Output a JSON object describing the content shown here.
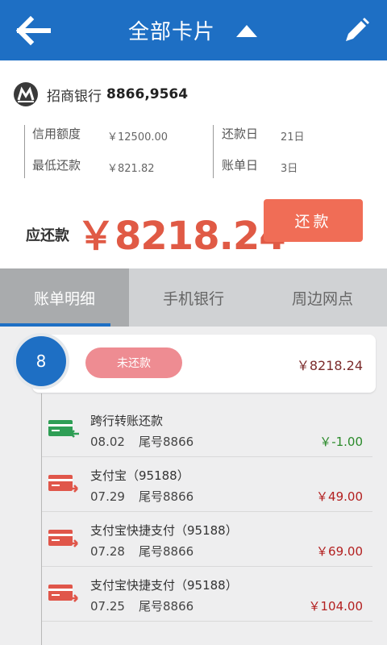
{
  "header": {
    "title": "全部卡片",
    "back_icon": "arrow-left-icon",
    "caret_icon": "caret-up-icon",
    "edit_icon": "pencil-icon"
  },
  "card": {
    "bank_name": "招商银行",
    "card_number": "8866,9564",
    "credit_limit_label": "信用额度",
    "credit_limit_value": "￥12500.00",
    "min_payment_label": "最低还款",
    "min_payment_value": "￥821.82",
    "repay_day_label": "还款日",
    "repay_day_value": "21日",
    "bill_day_label": "账单日",
    "bill_day_value": "3日",
    "due_label": "应还款",
    "due_amount": "￥8218.24",
    "pay_button": "还款"
  },
  "tabs": [
    {
      "label": "账单明细",
      "active": true
    },
    {
      "label": "手机银行",
      "active": false
    },
    {
      "label": "周边网点",
      "active": false
    }
  ],
  "summary": {
    "count": "8",
    "status": "未还款",
    "amount": "￥8218.24"
  },
  "transactions": [
    {
      "name": "跨行转账还款",
      "date": "08.02",
      "tail": "尾号8866",
      "amount": "￥-1.00",
      "type": "credit"
    },
    {
      "name": "支付宝（95188）",
      "date": "07.29",
      "tail": "尾号8866",
      "amount": "￥49.00",
      "type": "debit"
    },
    {
      "name": "支付宝快捷支付（95188）",
      "date": "07.28",
      "tail": "尾号8866",
      "amount": "￥69.00",
      "type": "debit"
    },
    {
      "name": "支付宝快捷支付（95188）",
      "date": "07.25",
      "tail": "尾号8866",
      "amount": "￥104.00",
      "type": "debit"
    }
  ],
  "colors": {
    "primary": "#1e6fc4",
    "accent": "#f06d56",
    "credit": "#2a8a2a",
    "debit": "#b32020"
  }
}
